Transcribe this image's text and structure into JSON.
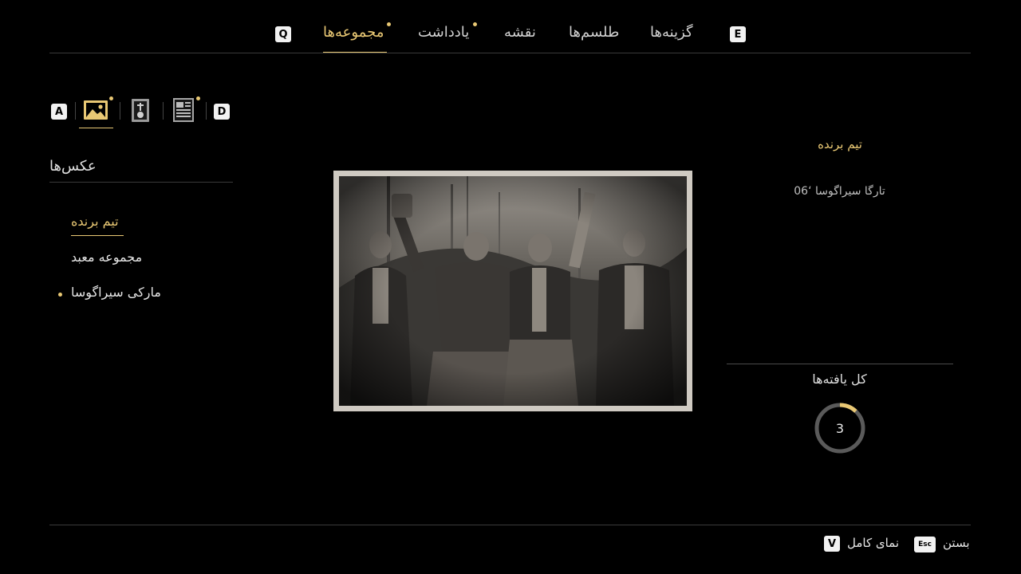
{
  "nav": {
    "left_key": "Q",
    "right_key": "E",
    "tabs": [
      {
        "label": "مجموعه‌ها",
        "active": true,
        "has_dot": true
      },
      {
        "label": "یادداشت",
        "active": false,
        "has_dot": true
      },
      {
        "label": "نقشه",
        "active": false,
        "has_dot": false
      },
      {
        "label": "طلسم‌ها",
        "active": false,
        "has_dot": false
      },
      {
        "label": "گزینه‌ها",
        "active": false,
        "has_dot": false
      }
    ]
  },
  "categories": {
    "left_key": "A",
    "right_key": "D",
    "items": [
      {
        "icon": "photo-icon",
        "active": true,
        "has_dot": true
      },
      {
        "icon": "shrine-icon",
        "active": false,
        "has_dot": false
      },
      {
        "icon": "document-icon",
        "active": false,
        "has_dot": true
      }
    ]
  },
  "list": {
    "title": "عکس‌ها",
    "items": [
      {
        "label": "تیم برنده",
        "active": true,
        "has_dot": false
      },
      {
        "label": "مجموعه معبد",
        "active": false,
        "has_dot": false
      },
      {
        "label": "مارکی سیراگوسا",
        "active": false,
        "has_dot": true
      }
    ]
  },
  "detail": {
    "title": "تیم برنده",
    "subtitle": "تارگا سیراگوسا ‘06",
    "found_label": "کل یافته‌ها",
    "found_count": "3",
    "progress_fraction": 0.12
  },
  "footer": {
    "close_key": "Esc",
    "close_label": "بستن",
    "full_view_key": "V",
    "full_view_label": "نمای کامل"
  },
  "colors": {
    "accent": "#e9c874",
    "background": "#000000",
    "ring_track": "#5a5a5a"
  }
}
